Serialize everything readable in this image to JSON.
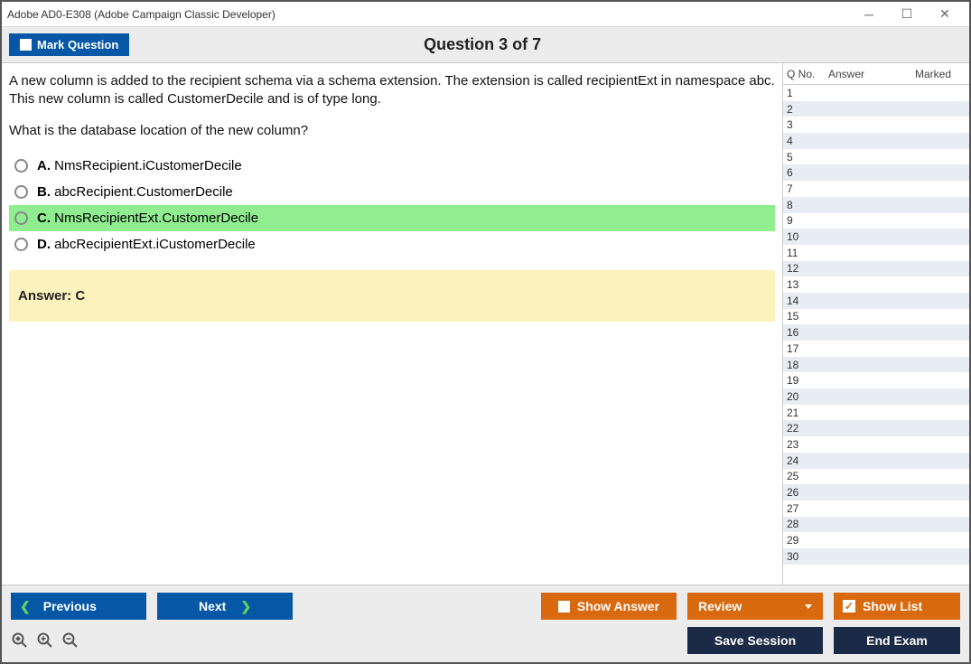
{
  "window": {
    "title": "Adobe AD0-E308 (Adobe Campaign Classic Developer)"
  },
  "header": {
    "mark_label": "Mark Question",
    "question_counter": "Question 3 of 7"
  },
  "question": {
    "para1": "A new column is added to the recipient schema via a schema extension. The extension is called recipientExt in namespace abc. This new column is called CustomerDecile and is of type long.",
    "para2": "What is the database location of the new column?",
    "options": [
      {
        "letter": "A.",
        "text": "NmsRecipient.iCustomerDecile",
        "highlight": false
      },
      {
        "letter": "B.",
        "text": "abcRecipient.CustomerDecile",
        "highlight": false
      },
      {
        "letter": "C.",
        "text": "NmsRecipientExt.CustomerDecile",
        "highlight": true
      },
      {
        "letter": "D.",
        "text": "abcRecipientExt.iCustomerDecile",
        "highlight": false
      }
    ],
    "answer_label": "Answer: C"
  },
  "sidepanel": {
    "col_qno": "Q No.",
    "col_answer": "Answer",
    "col_marked": "Marked",
    "rows": [
      {
        "q": "1"
      },
      {
        "q": "2"
      },
      {
        "q": "3"
      },
      {
        "q": "4"
      },
      {
        "q": "5"
      },
      {
        "q": "6"
      },
      {
        "q": "7"
      },
      {
        "q": "8"
      },
      {
        "q": "9"
      },
      {
        "q": "10"
      },
      {
        "q": "11"
      },
      {
        "q": "12"
      },
      {
        "q": "13"
      },
      {
        "q": "14"
      },
      {
        "q": "15"
      },
      {
        "q": "16"
      },
      {
        "q": "17"
      },
      {
        "q": "18"
      },
      {
        "q": "19"
      },
      {
        "q": "20"
      },
      {
        "q": "21"
      },
      {
        "q": "22"
      },
      {
        "q": "23"
      },
      {
        "q": "24"
      },
      {
        "q": "25"
      },
      {
        "q": "26"
      },
      {
        "q": "27"
      },
      {
        "q": "28"
      },
      {
        "q": "29"
      },
      {
        "q": "30"
      }
    ]
  },
  "footer": {
    "previous": "Previous",
    "next": "Next",
    "show_answer": "Show Answer",
    "review": "Review",
    "show_list": "Show List",
    "save_session": "Save Session",
    "end_exam": "End Exam"
  }
}
